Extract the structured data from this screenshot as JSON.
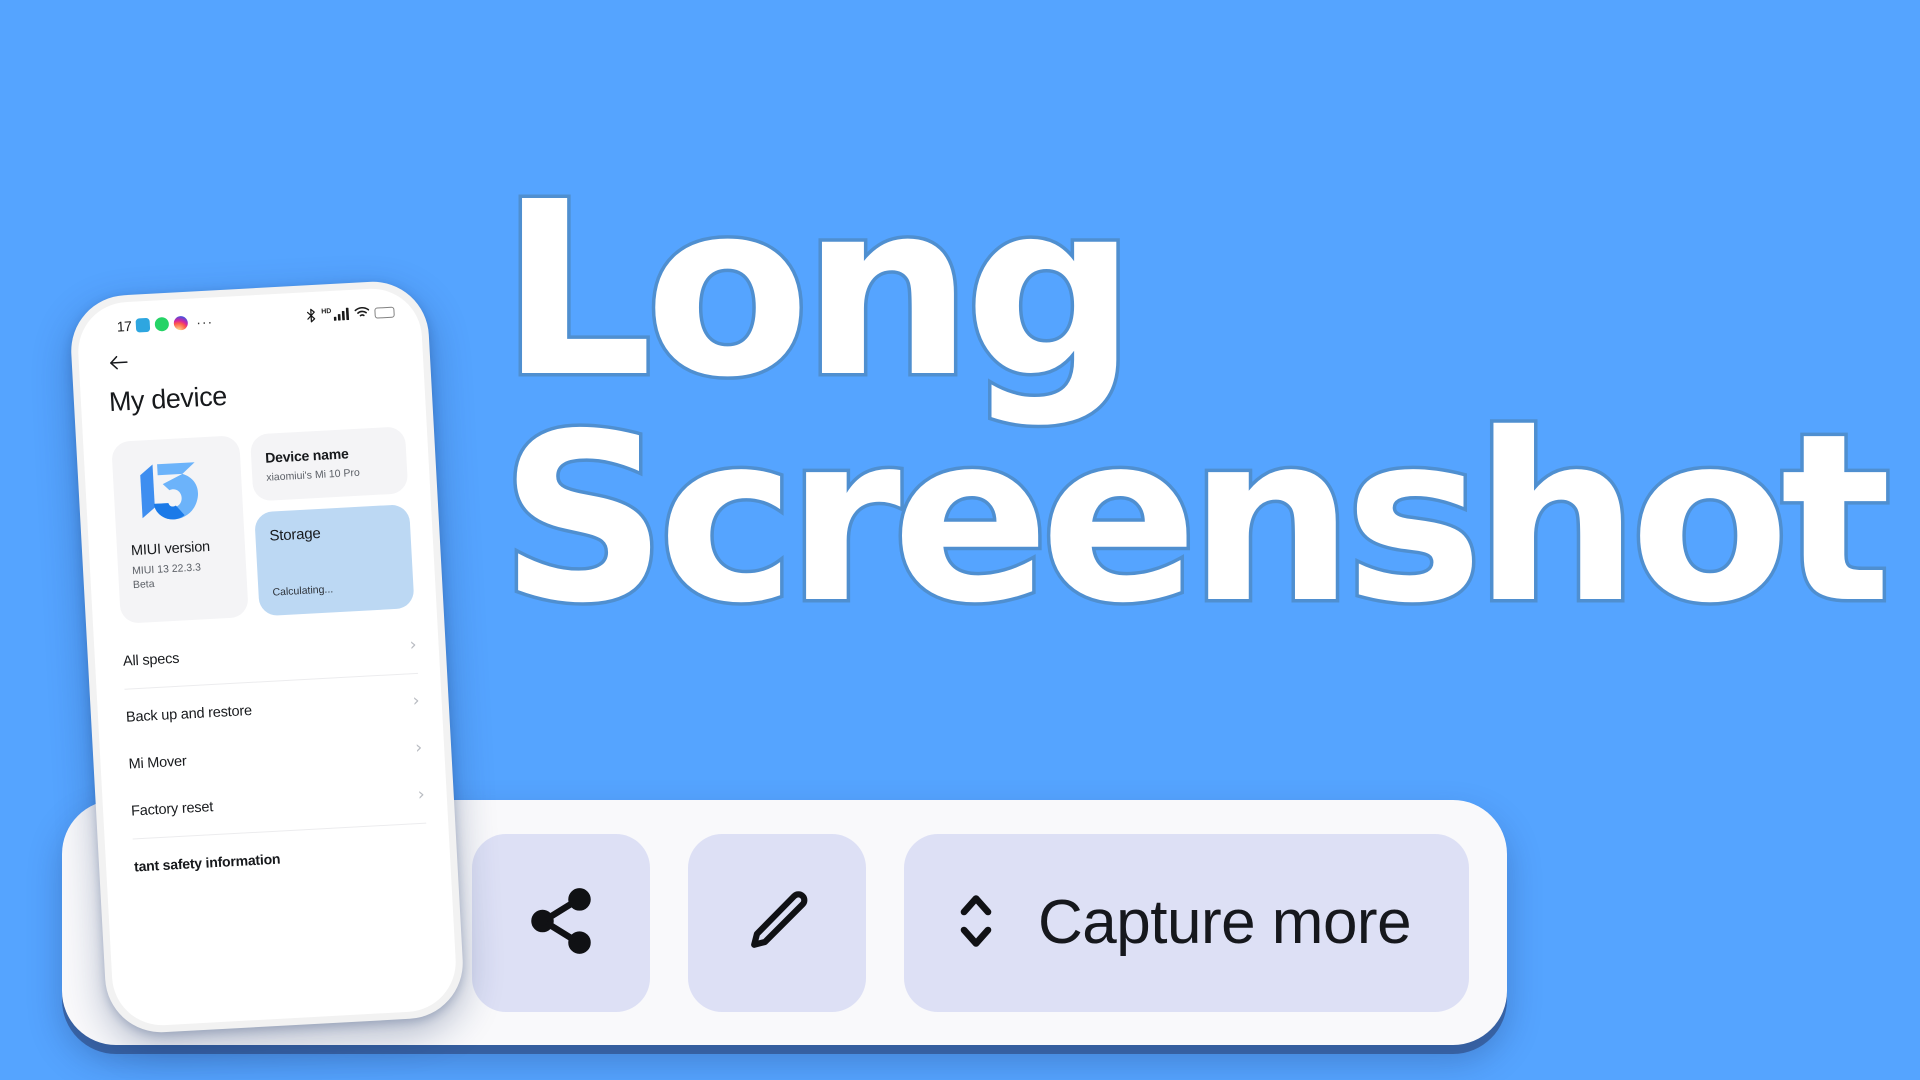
{
  "theme": {
    "background": "#55a4ff",
    "title_stroke": "#4f8fd0",
    "toolbar_bg": "#f9f9fb",
    "button_bg": "#dde0f5",
    "storage_card_bg": "#bcd8f3",
    "card_bg": "#f4f4f6"
  },
  "hero": {
    "line1": "Long",
    "line2": "Screenshot"
  },
  "toolbar": {
    "share_icon": "share-icon",
    "edit_icon": "pencil-icon",
    "capture_icon": "chevron-up-down-icon",
    "capture_label": "Capture more"
  },
  "phone": {
    "statusbar": {
      "time": "17",
      "signal_dots": "..",
      "app_icons": [
        "telegram-icon",
        "whatsapp-icon",
        "instagram-icon"
      ],
      "overflow": "···",
      "bluetooth": "✶",
      "hd": "HD",
      "signal": "signal-bars-icon",
      "wifi": "wifi-icon",
      "battery": "battery-icon"
    },
    "back_icon": "back-arrow-icon",
    "page_title": "My device",
    "cards": {
      "miui": {
        "logo": "miui-13-logo",
        "heading": "MIUI version",
        "sub_line1": "MIUI 13 22.3.3",
        "sub_line2": "Beta"
      },
      "device_name": {
        "heading": "Device name",
        "value": "xiaomiui's Mi 10 Pro"
      },
      "storage": {
        "heading": "Storage",
        "value": "Calculating..."
      }
    },
    "list": [
      {
        "label": "All specs",
        "chevron": "›"
      },
      {
        "label": "Back up and restore",
        "chevron": "›"
      },
      {
        "label": "Mi Mover",
        "chevron": "›"
      },
      {
        "label": "Factory reset",
        "chevron": "›"
      },
      {
        "label": "tant safety information",
        "chevron": ""
      }
    ]
  }
}
